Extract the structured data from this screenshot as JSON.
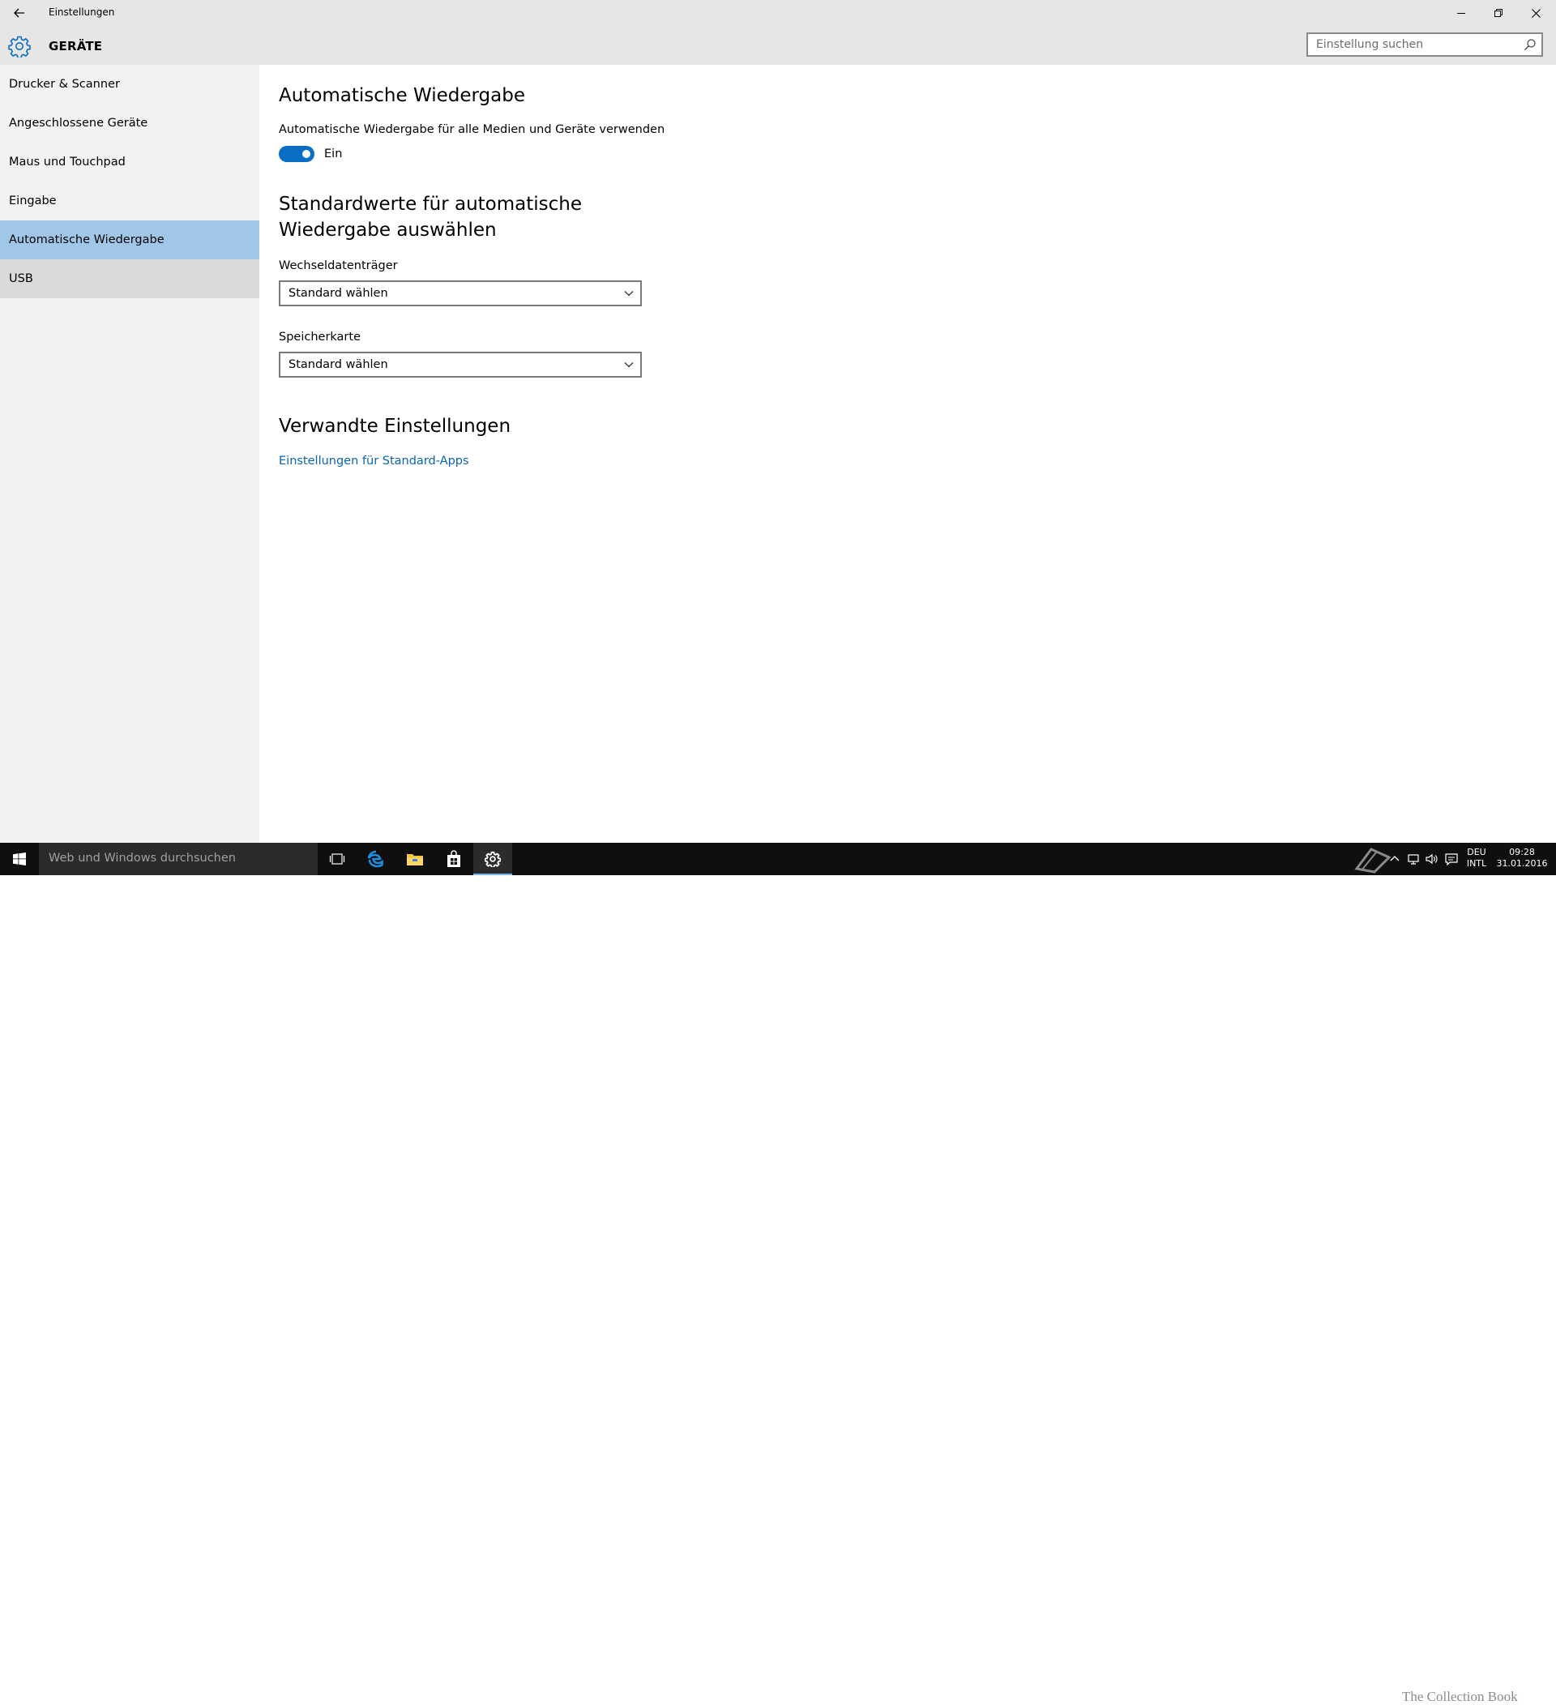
{
  "window": {
    "title": "Einstellungen"
  },
  "header": {
    "section_title": "GERÄTE",
    "search_placeholder": "Einstellung suchen"
  },
  "sidebar": {
    "items": [
      {
        "label": "Drucker & Scanner",
        "state": "normal"
      },
      {
        "label": "Angeschlossene Geräte",
        "state": "normal"
      },
      {
        "label": "Maus und Touchpad",
        "state": "normal"
      },
      {
        "label": "Eingabe",
        "state": "normal"
      },
      {
        "label": "Automatische Wiedergabe",
        "state": "selected"
      },
      {
        "label": "USB",
        "state": "hover"
      }
    ]
  },
  "main": {
    "heading": "Automatische Wiedergabe",
    "toggle": {
      "description": "Automatische Wiedergabe für alle Medien und Geräte verwenden",
      "state_label": "Ein",
      "on": true
    },
    "defaults_heading_line1": "Standardwerte für automatische",
    "defaults_heading_line2": "Wiedergabe auswählen",
    "removable_drive": {
      "label": "Wechseldatenträger",
      "value": "Standard wählen"
    },
    "memory_card": {
      "label": "Speicherkarte",
      "value": "Standard wählen"
    },
    "related_heading": "Verwandte Einstellungen",
    "related_link": "Einstellungen für Standard-Apps"
  },
  "taskbar": {
    "search_placeholder": "Web und Windows durchsuchen",
    "language_line1": "DEU",
    "language_line2": "INTL",
    "time": "09:28",
    "date": "31.01.2016",
    "watermark": "The Collection Book"
  },
  "colors": {
    "accent": "#0a6ec4",
    "selected_nav": "#a0c7e8",
    "link": "#0a64b4",
    "taskbar": "#0f0f0f"
  }
}
